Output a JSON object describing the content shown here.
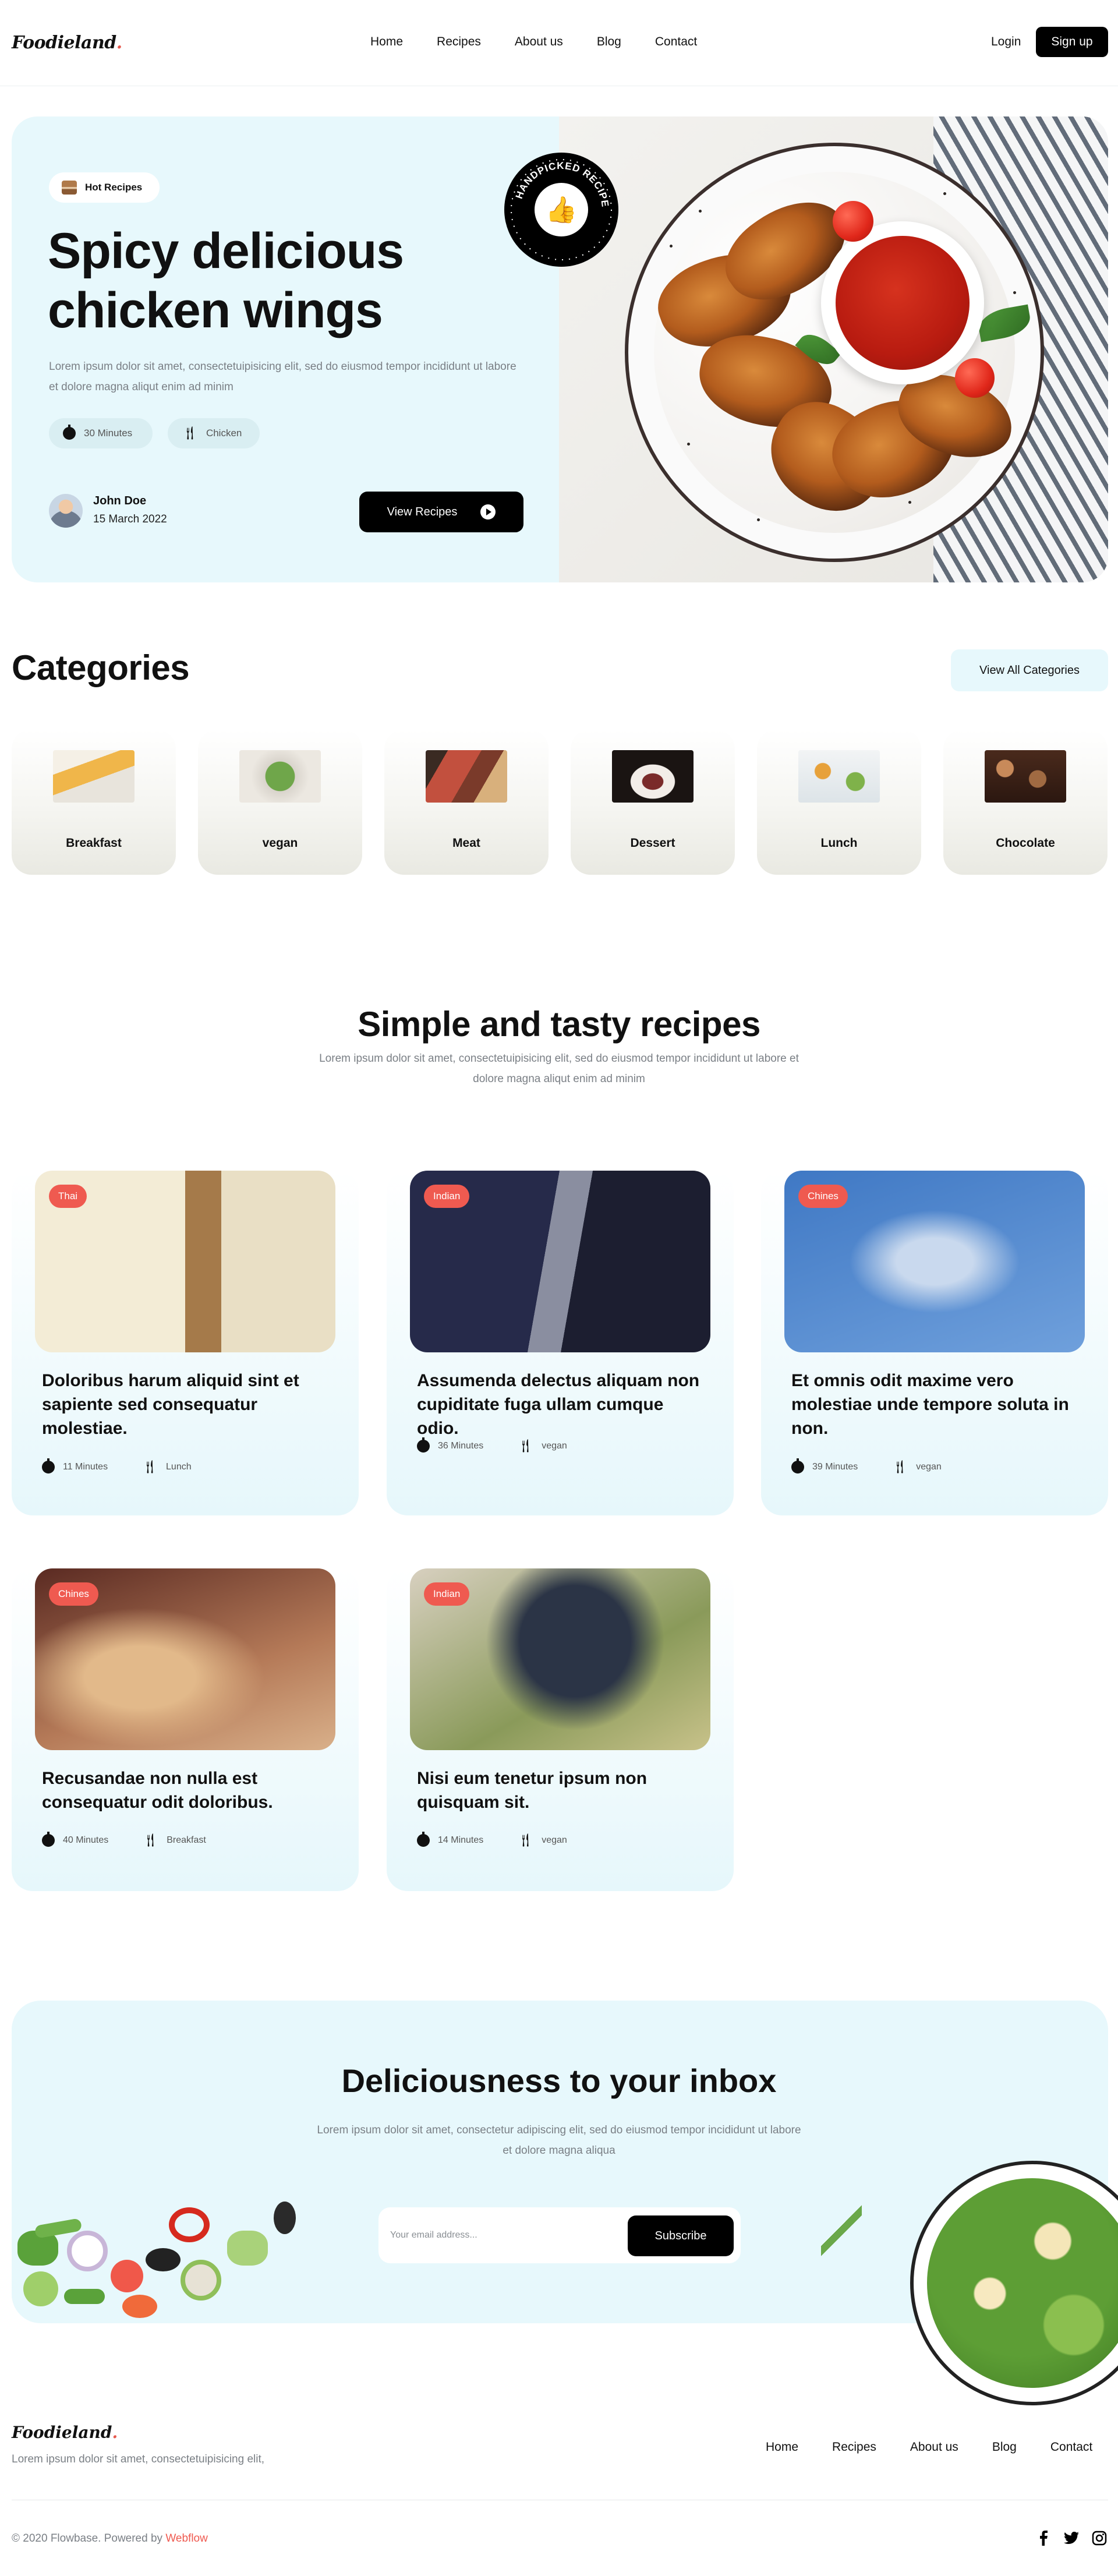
{
  "nav": {
    "logo": "Foodieland",
    "logo_dot": ".",
    "links": [
      "Home",
      "Recipes",
      "About us",
      "Blog",
      "Contact"
    ],
    "login": "Login",
    "signup": "Sign up"
  },
  "hero": {
    "badge": "Hot Recipes",
    "title_line1": "Spicy delicious",
    "title_line2": "chicken wings",
    "description": "Lorem ipsum dolor sit amet, consectetuipisicing elit, sed do eiusmod tempor incididunt ut labore et dolore magna aliqut enim ad minim",
    "time": "30 Minutes",
    "category": "Chicken",
    "author": "John Doe",
    "date": "15 March 2022",
    "cta": "View Recipes",
    "stamp_text": "HANDPICKED RECIPES"
  },
  "categories": {
    "title": "Categories",
    "button": "View All Categories",
    "items": [
      "Breakfast",
      "vegan",
      "Meat",
      "Dessert",
      "Lunch",
      "Chocolate"
    ]
  },
  "recipes": {
    "title": "Simple and tasty recipes",
    "description": "Lorem ipsum dolor sit amet, consectetuipisicing elit, sed do eiusmod tempor incididunt ut labore et dolore magna aliqut enim ad minim",
    "items": [
      {
        "tag": "Thai",
        "title": "Doloribus harum aliquid sint et sapiente sed consequatur molestiae.",
        "time": "11 Minutes",
        "category": "Lunch"
      },
      {
        "tag": "Indian",
        "title": "Assumenda delectus aliquam non cupiditate fuga ullam cumque odio.",
        "time": "36 Minutes",
        "category": "vegan"
      },
      {
        "tag": "Chines",
        "title": "Et omnis odit maxime vero molestiae unde tempore soluta in non.",
        "time": "39 Minutes",
        "category": "vegan"
      },
      {
        "tag": "Chines",
        "title": "Recusandae non nulla est consequatur odit doloribus.",
        "time": "40 Minutes",
        "category": "Breakfast"
      },
      {
        "tag": "Indian",
        "title": "Nisi eum tenetur ipsum non quisquam sit.",
        "time": "14 Minutes",
        "category": "vegan"
      }
    ]
  },
  "newsletter": {
    "title": "Deliciousness to your inbox",
    "description": "Lorem ipsum dolor sit amet, consectetur adipiscing elit, sed do eiusmod tempor incididunt ut labore et dolore magna aliqua",
    "placeholder": "Your email address...",
    "button": "Subscribe"
  },
  "footer": {
    "logo": "Foodieland",
    "logo_dot": ".",
    "description": "Lorem ipsum dolor sit amet, consectetuipisicing elit,",
    "links": [
      "Home",
      "Recipes",
      "About us",
      "Blog",
      "Contact"
    ],
    "copyright": "© 2020 Flowbase. Powered by ",
    "powered_by": "Webflow",
    "social_icons": [
      "facebook-icon",
      "twitter-icon",
      "instagram-icon"
    ]
  },
  "colors": {
    "accent": "#ef5a50",
    "light_blue": "#e7f8fc",
    "black": "#000000"
  }
}
